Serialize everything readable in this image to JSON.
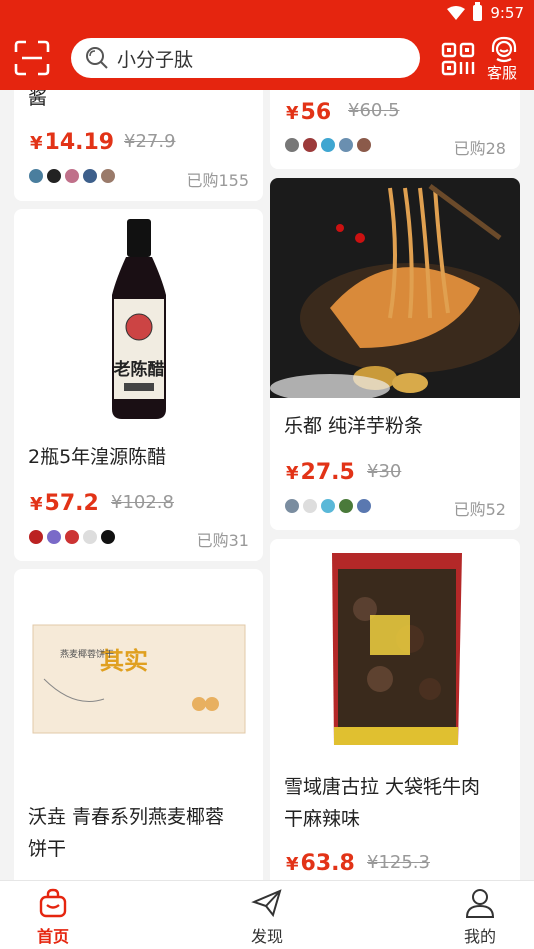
{
  "status": {
    "time": "9:57"
  },
  "header": {
    "search_text": "小分子肽",
    "service_label": "客服"
  },
  "cards": {
    "c1": {
      "name_tail": "酱",
      "price": "14.19",
      "original": "27.9",
      "sold": "已购155"
    },
    "c2": {
      "price": "56",
      "original": "60.5",
      "sold": "已购28"
    },
    "c3": {
      "name": "2瓶5年湟源陈醋",
      "price": "57.2",
      "original": "102.8",
      "sold": "已购31",
      "bottle_label": "老陈醋"
    },
    "c4": {
      "name": "乐都 纯洋芋粉条",
      "price": "27.5",
      "original": "30",
      "sold": "已购52"
    },
    "c5": {
      "name_line1": "沃垚 青春系列燕麦椰蓉",
      "name_line2": "饼干",
      "box_text": "其实",
      "box_brand": "燕麦椰蓉饼干"
    },
    "c6": {
      "name_line1": "雪域唐古拉 大袋牦牛肉",
      "name_line2": "干麻辣味",
      "price": "63.8",
      "original": "125.3"
    }
  },
  "currency": "¥",
  "nav": [
    {
      "label": "首页",
      "active": true
    },
    {
      "label": "发现",
      "active": false
    },
    {
      "label": "我的",
      "active": false
    }
  ],
  "colors": {
    "brand": "#e5250f",
    "price": "#e23317"
  }
}
